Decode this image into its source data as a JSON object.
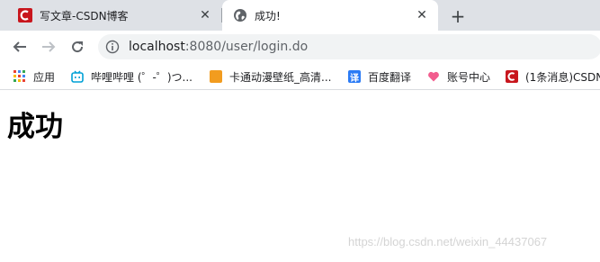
{
  "tabs": [
    {
      "title": "写文章-CSDN博客",
      "close": "✕",
      "active": false
    },
    {
      "title": "成功!",
      "close": "✕",
      "active": true
    }
  ],
  "newtab": "+",
  "omnibox": {
    "host": "localhost",
    "path": ":8080/user/login.do"
  },
  "bookmarks": [
    {
      "label": "应用",
      "icon": "apps-grid-icon"
    },
    {
      "label": "哔哩哔哩 (゜-゜)つ...",
      "icon": "bilibili-icon"
    },
    {
      "label": "卡通动漫壁纸_高清...",
      "icon": "wallpaper-icon"
    },
    {
      "label": "百度翻译",
      "icon": "translate-icon",
      "icon_text": "译"
    },
    {
      "label": "账号中心",
      "icon": "heart-icon"
    },
    {
      "label": "(1条消息)CSDN",
      "icon": "csdn-icon"
    }
  ],
  "page": {
    "heading": "成功"
  },
  "watermark": "https://blog.csdn.net/weixin_44437067",
  "colors": {
    "csdn_red": "#c8161d",
    "accent_blue": "#1a73e8",
    "bilibili": "#00a1d6",
    "heart": "#f25d8e"
  }
}
